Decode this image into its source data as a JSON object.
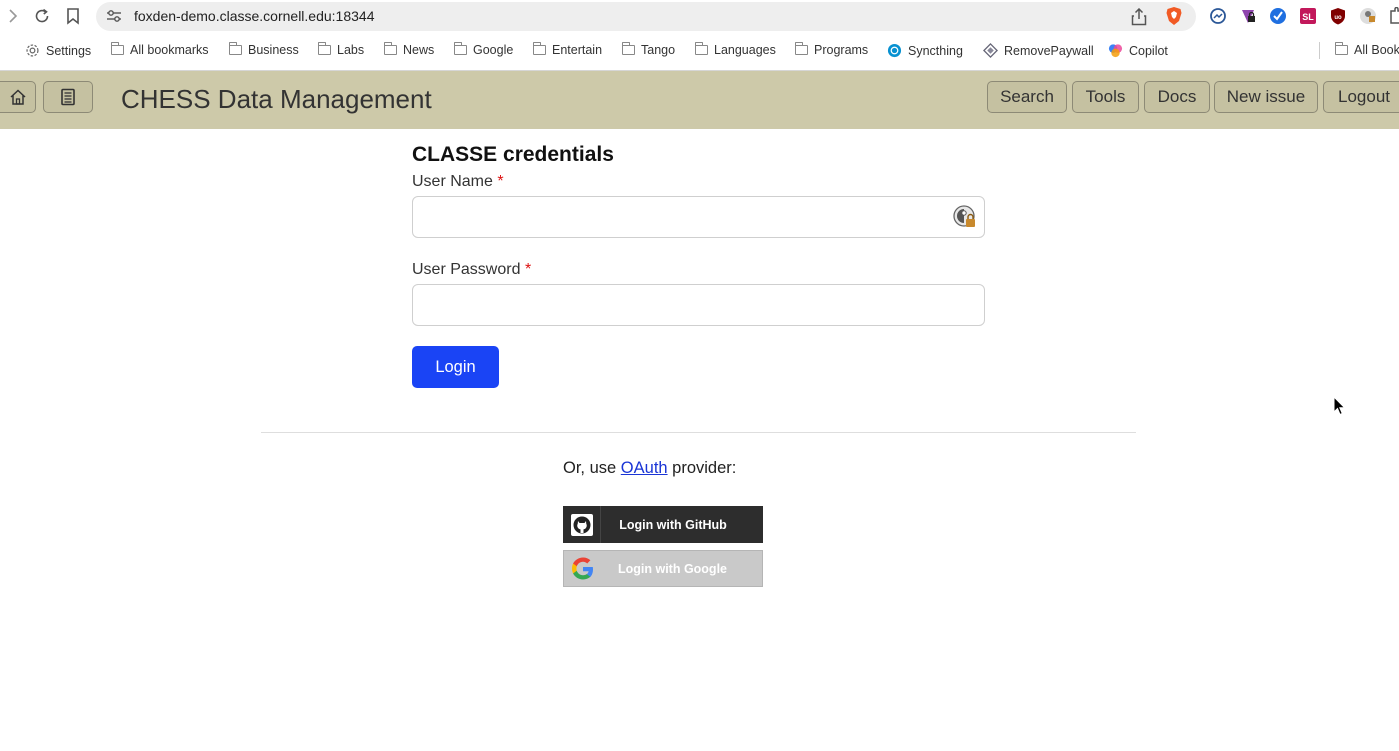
{
  "browser": {
    "url": "foxden-demo.classe.cornell.edu:18344",
    "bookmarks": [
      {
        "label": "Settings",
        "icon": "gear-icon"
      },
      {
        "label": "All bookmarks",
        "icon": "folder-icon"
      },
      {
        "label": "Business",
        "icon": "folder-icon"
      },
      {
        "label": "Labs",
        "icon": "folder-icon"
      },
      {
        "label": "News",
        "icon": "folder-icon"
      },
      {
        "label": "Google",
        "icon": "folder-icon"
      },
      {
        "label": "Entertain",
        "icon": "folder-icon"
      },
      {
        "label": "Tango",
        "icon": "folder-icon"
      },
      {
        "label": "Languages",
        "icon": "folder-icon"
      },
      {
        "label": "Programs",
        "icon": "folder-icon"
      },
      {
        "label": "Syncthing",
        "icon": "syncthing-icon"
      },
      {
        "label": "RemovePaywall",
        "icon": "removepaywall-icon"
      },
      {
        "label": "Copilot",
        "icon": "copilot-icon"
      }
    ],
    "other_bookmarks": "All Book"
  },
  "app": {
    "title": "CHESS Data Management",
    "nav": {
      "search": "Search",
      "tools": "Tools",
      "docs": "Docs",
      "new_issue": "New issue",
      "logout": "Logout"
    },
    "header_bg": "#cdc9a9"
  },
  "form": {
    "title": "CLASSE credentials",
    "username_label": "User Name",
    "username_value": "",
    "password_label": "User Password",
    "password_value": "",
    "required_mark": "*",
    "login_label": "Login",
    "login_color": "#1a44f5"
  },
  "oauth": {
    "prefix": "Or, use",
    "link": "OAuth",
    "suffix": "provider:",
    "github_label": "Login with GitHub",
    "google_label": "Login with Google"
  }
}
